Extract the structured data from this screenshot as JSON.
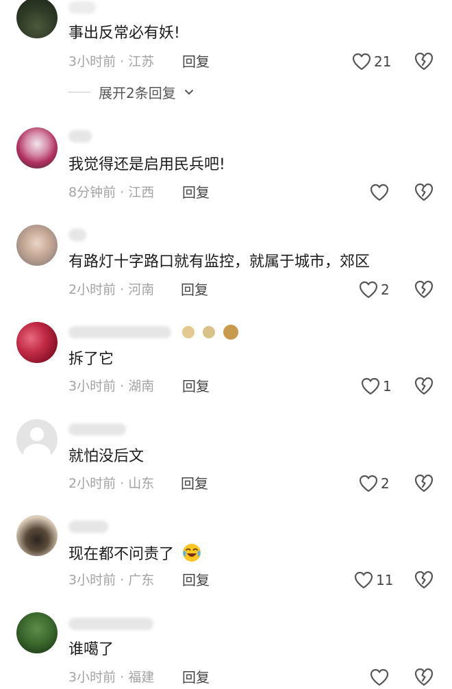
{
  "colors": {
    "icon_stroke": "#555555",
    "meta_text": "#a3a3a3",
    "body_text": "#1c1c1c"
  },
  "comments": [
    {
      "text": "事出反常必有妖!",
      "time": "3小时前",
      "location": "江苏",
      "reply_label": "回复",
      "likes": "21",
      "expand_label": "展开2条回复"
    },
    {
      "text": "我觉得还是启用民兵吧!",
      "time": "8分钟前",
      "location": "江西",
      "reply_label": "回复",
      "likes": ""
    },
    {
      "text": "有路灯十字路口就有监控，就属于城市，郊区",
      "time": "2小时前",
      "location": "河南",
      "reply_label": "回复",
      "likes": "2"
    },
    {
      "text": "拆了它",
      "time": "3小时前",
      "location": "湖南",
      "reply_label": "回复",
      "likes": "1"
    },
    {
      "text": "就怕没后文",
      "time": "2小时前",
      "location": "山东",
      "reply_label": "回复",
      "likes": "2"
    },
    {
      "text": "现在都不问责了",
      "time": "3小时前",
      "location": "广东",
      "reply_label": "回复",
      "likes": "11",
      "emoji": "crying-laughing-emoji"
    },
    {
      "text": "谁噶了",
      "time": "3小时前",
      "location": "福建",
      "reply_label": "回复",
      "likes": ""
    }
  ]
}
